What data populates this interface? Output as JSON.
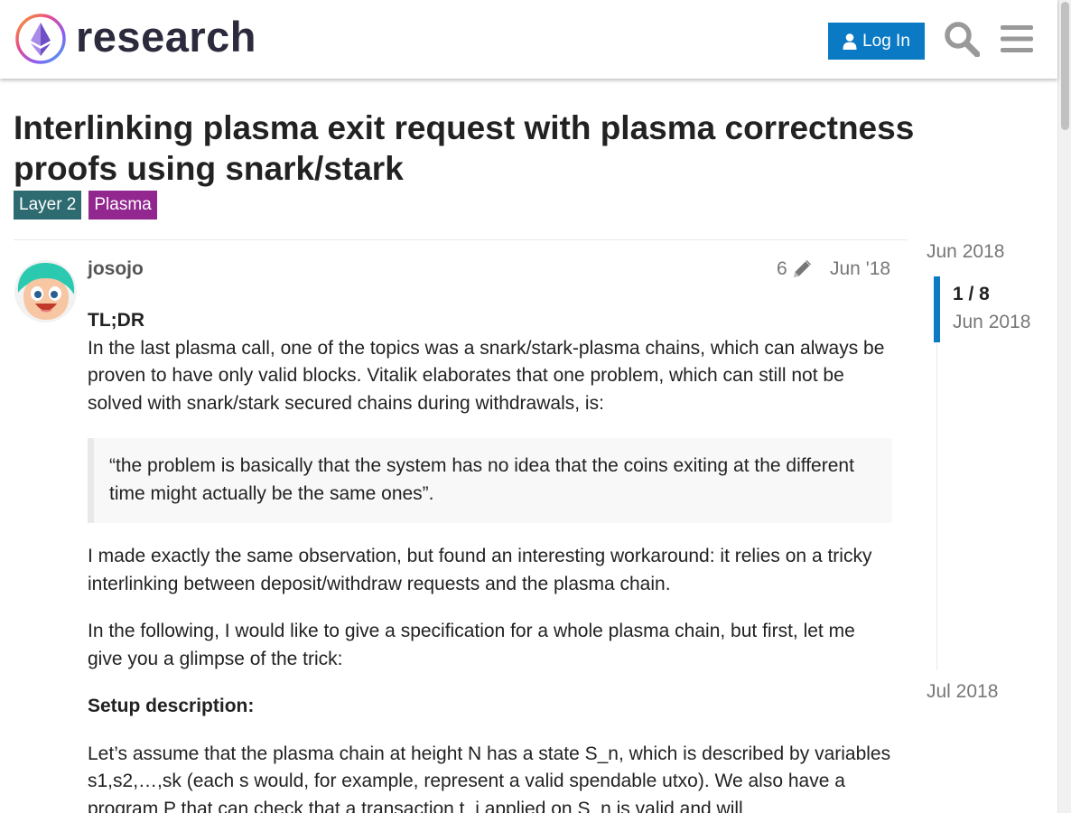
{
  "header": {
    "logo_text": "research",
    "login_label": "Log In"
  },
  "topic": {
    "title": "Interlinking plasma exit request with plasma correctness proofs using snark/stark",
    "tags": [
      {
        "label": "Layer 2",
        "color": "#2d6b70"
      },
      {
        "label": "Plasma",
        "color": "#92278f"
      }
    ]
  },
  "post": {
    "username": "josojo",
    "edit_count": "6",
    "date": "Jun '18",
    "tldr_heading": "TL;DR",
    "para1": "In the last plasma call, one of the topics was a snark/stark-plasma chains, which can always be proven to have only valid blocks. Vitalik elaborates that one problem, which can still not be solved with snark/stark secured chains during withdrawals, is:",
    "quote": "“the problem is basically that the system has no idea that the coins exiting at the different time might actually be the same ones”.",
    "para2": "I made exactly the same observation, but found an interesting workaround: it relies on a tricky interlinking between deposit/withdraw requests and the plasma chain.",
    "para3": "In the following, I would like to give a specification for a whole plasma chain, but first, let me give you a glimpse of the trick:",
    "setup_heading": "Setup description:",
    "para4": "Let’s assume that the plasma chain at height N has a state S_n, which is described by variables s1,s2,…,sk (each s would, for example, represent a valid spendable utxo). We also have a program P that can check that a transaction t_i applied on S_n is valid and will"
  },
  "timeline": {
    "start_date": "Jun 2018",
    "position": "1 / 8",
    "position_date": "Jun 2018",
    "end_date": "Jul 2018"
  },
  "colors": {
    "brand_blue": "#0a7ac4"
  }
}
